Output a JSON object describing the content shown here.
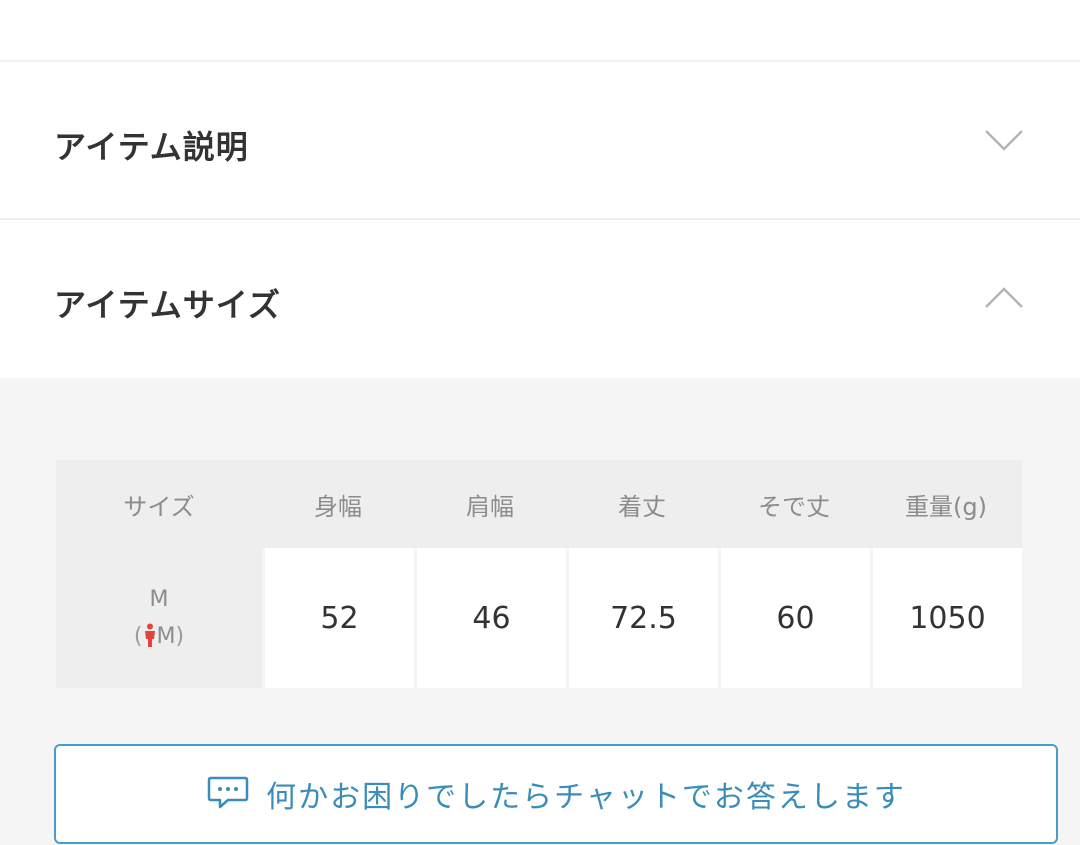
{
  "accordion": {
    "description_title": "アイテム説明",
    "size_title": "アイテムサイズ"
  },
  "size_table": {
    "headers": [
      "サイズ",
      "身幅",
      "肩幅",
      "着丈",
      "そで丈",
      "重量(g)"
    ],
    "rows": [
      {
        "size": "M",
        "model_size": "M",
        "values": [
          "52",
          "46",
          "72.5",
          "60",
          "1050"
        ]
      }
    ]
  },
  "chat": {
    "label": "何かお困りでしたらチャットでお答えします",
    "icon": "chat-bubble-icon"
  },
  "colors": {
    "accent": "#3a8db8",
    "model_icon": "#e0443a",
    "panel_bg": "#f5f5f5",
    "header_bg": "#eeeeee"
  }
}
